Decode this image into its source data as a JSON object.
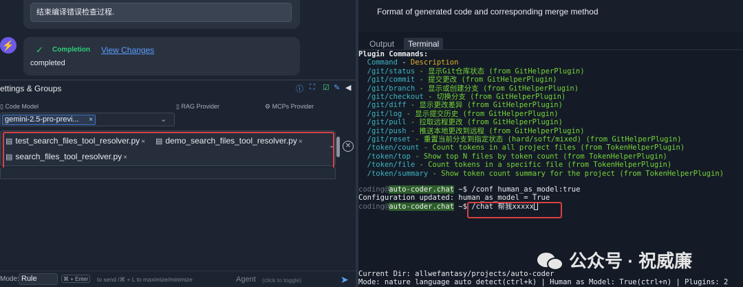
{
  "chat": {
    "prev_message": "结束编译错误检查过程.",
    "bolt_icon": "⚡",
    "completion": {
      "check_icon": "✓",
      "label": "Completion",
      "view_changes": "View Changes",
      "status": "completed"
    }
  },
  "settings": {
    "title": "ettings & Groups",
    "toolbar_icons": [
      "help-icon",
      "expand-icon",
      "check-icon",
      "edit-icon",
      "sound-icon"
    ]
  },
  "providers": {
    "code_model_label": "Code Model",
    "rag_label": "RAG Provider",
    "mcps_label": "MCPs Provider",
    "model_value": "gemini-2.5-pro-previ...",
    "chip_close": "×",
    "chevron": "⌄"
  },
  "files": [
    {
      "name": "test_search_files_tool_resolver.py",
      "close": "×"
    },
    {
      "name": "demo_search_files_tool_resolver.py",
      "close": "×"
    },
    {
      "name": "search_files_tool_resolver.py",
      "close": "×"
    }
  ],
  "bottom": {
    "mode_label": "Mode:",
    "mode_value": "Rule",
    "kbd_send": "⌘ + Enter",
    "hint_send": "to send /⌘ + L to maximize/minimize",
    "agent_label": "Agent",
    "agent_hint": "(click to toggle)"
  },
  "terminal": {
    "top_description": "Format of generated code and corresponding merge method",
    "tabs": [
      "Output",
      "Terminal"
    ],
    "plugin_header": "Plugin Commands:",
    "command_col": "Command",
    "dash": "-",
    "description_col": "Description",
    "commands": [
      {
        "cmd": "/git/status",
        "desc": "- 显示Git仓库状态 (from GitHelperPlugin)"
      },
      {
        "cmd": "/git/commit",
        "desc": "- 提交更改 (from GitHelperPlugin)"
      },
      {
        "cmd": "/git/branch",
        "desc": "- 显示或创建分支 (from GitHelperPlugin)"
      },
      {
        "cmd": "/git/checkout",
        "desc": "- 切换分支 (from GitHelperPlugin)"
      },
      {
        "cmd": "/git/diff",
        "desc": "- 显示更改差异 (from GitHelperPlugin)"
      },
      {
        "cmd": "/git/log",
        "desc": "- 显示提交历史 (from GitHelperPlugin)"
      },
      {
        "cmd": "/git/pull",
        "desc": "- 拉取远程更改 (from GitHelperPlugin)"
      },
      {
        "cmd": "/git/push",
        "desc": "- 推送本地更改到远程 (from GitHelperPlugin)"
      },
      {
        "cmd": "/git/reset",
        "desc": "- 重置当前分支到指定状态 (hard/soft/mixed) (from GitHelperPlugin)"
      },
      {
        "cmd": "/token/count",
        "desc": "- Count tokens in all project files (from TokenHelperPlugin)"
      },
      {
        "cmd": "/token/top",
        "desc": "- Show top N files by token count (from TokenHelperPlugin)"
      },
      {
        "cmd": "/token/file",
        "desc": "- Count tokens in a specific file (from TokenHelperPlugin)"
      },
      {
        "cmd": "/token/summary",
        "desc": "- Show token count summary for the project (from TokenHelperPlugin)"
      }
    ],
    "prompt_user": "coding@",
    "prompt_host": "auto-coder.chat",
    "prompt_tilde": " ~$",
    "cmd1": " /conf human_as_model:true",
    "config_output": "Configuration updated: human_as_model = True",
    "cmd2": " /chat 帮我xxxxx",
    "current_dir": "Current Dir: allwefantasy/projects/auto-coder",
    "mode_line": "Mode: nature language auto detect(ctrl+k) | Human as Model: True(ctrl+n) | Plugins: 2"
  },
  "watermark": "公众号 · 祝威廉"
}
